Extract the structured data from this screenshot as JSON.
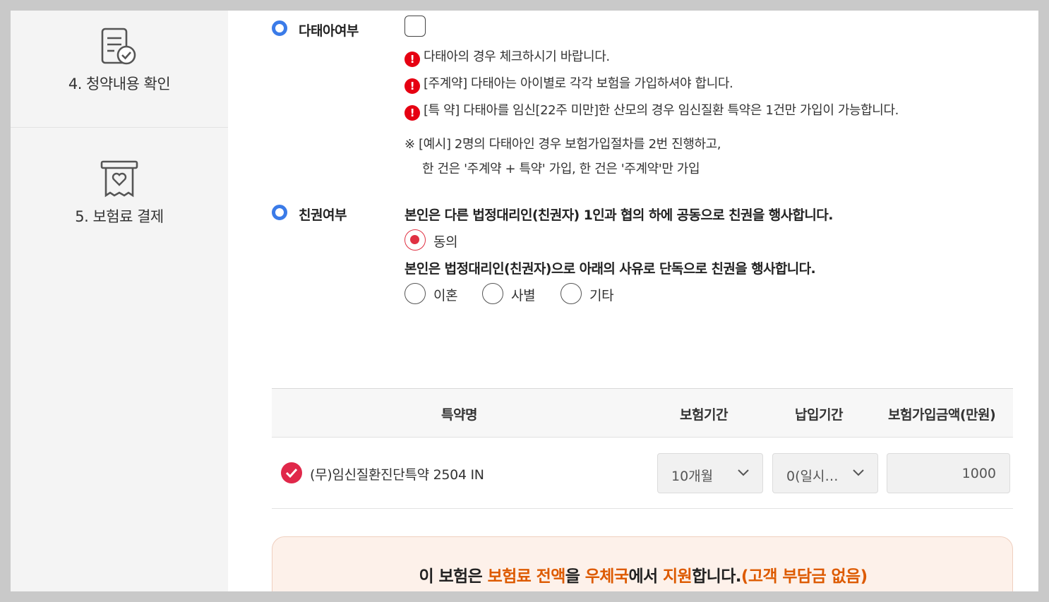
{
  "sidebar": {
    "steps": [
      {
        "label": "4. 청약내용 확인",
        "icon": "document-check-icon"
      },
      {
        "label": "5. 보험료 결제",
        "icon": "receipt-heart-icon"
      }
    ]
  },
  "twins": {
    "title": "다태아여부",
    "checked": false,
    "warnings": [
      "다태아의 경우 체크하시기 바랍니다.",
      "[주계약] 다태아는 아이별로 각각 보험을 가입하셔야 합니다.",
      "[특 약] 다태아를 임신[22주 미만]한 산모의 경우 임신질환 특약은 1건만 가입이 가능합니다."
    ],
    "note_line1": "※ [예시] 2명의 다태아인 경우 보험가입절차를 2번 진행하고,",
    "note_line2": "한 건은 '주계약 + 특약' 가입, 한 건은 '주계약'만 가입"
  },
  "custody": {
    "title": "친권여부",
    "joint_statement": "본인은 다른 법정대리인(친권자) 1인과 협의 하에 공동으로 친권을 행사합니다.",
    "agree_label": "동의",
    "sole_statement": "본인은 법정대리인(친권자)으로 아래의 사유로 단독으로 친권을 행사합니다.",
    "reasons": [
      "이혼",
      "사별",
      "기타"
    ]
  },
  "rider_table": {
    "headers": [
      "특약명",
      "보험기간",
      "납입기간",
      "보험가입금액(만원)"
    ],
    "rows": [
      {
        "name": "(무)임신질환진단특약 2504 IN",
        "period": "10개월",
        "payment": "0(일시…",
        "amount": "1000"
      }
    ]
  },
  "banner": {
    "parts": [
      "이 보험은 ",
      "보험료 전액",
      "을 ",
      "우체국",
      "에서 ",
      "지원",
      "합니다.",
      "(고객 부담금 없음)"
    ]
  },
  "colors": {
    "accent_blue": "#3b7be8",
    "accent_red": "#e03042",
    "warning_red": "#e60012",
    "highlight_orange": "#dd5a00"
  }
}
